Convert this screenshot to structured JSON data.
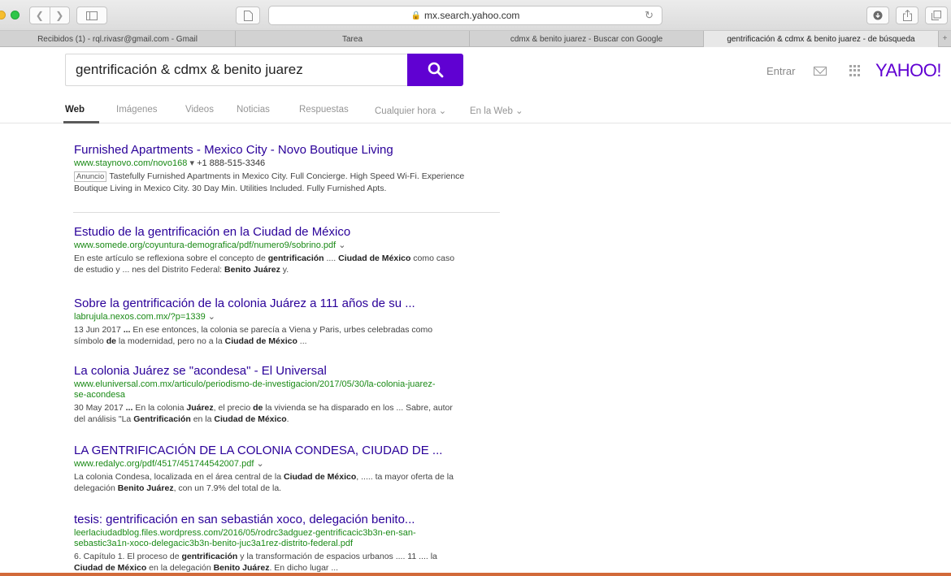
{
  "browser": {
    "url": "mx.search.yahoo.com",
    "tabs": [
      {
        "label": "Recibidos (1) - rql.rivasr@gmail.com - Gmail"
      },
      {
        "label": "Tarea"
      },
      {
        "label": "cdmx & benito juarez - Buscar con Google"
      },
      {
        "label": "gentrificación & cdmx & benito juarez - de búsqueda"
      }
    ],
    "new_tab_label": "+"
  },
  "header": {
    "query": "gentrificación & cdmx & benito juarez",
    "signin": "Entrar",
    "logo": "YAHOO!",
    "brand_color": "#6001d2"
  },
  "nav": {
    "tabs": [
      "Web",
      "Imágenes",
      "Videos",
      "Noticias",
      "Respuestas",
      "Cualquier hora ⌄",
      "En la Web ⌄"
    ]
  },
  "ad": {
    "title": "Furnished Apartments - Mexico City - Novo Boutique Living",
    "url": "www.staynovo.com/novo168",
    "url_arrow": "▾",
    "phone": "+1 888-515-3346",
    "label": "Anuncio",
    "snippet_line1": "Tastefully Furnished Apartments in Mexico City. Full Concierge. High Speed Wi-Fi. Experience",
    "snippet_line2": "Boutique Living in Mexico City. 30 Day Min. Utilities Included. Fully Furnished Apts."
  },
  "results": [
    {
      "title": "Estudio de la gentrificación en la Ciudad de México",
      "url": "www.somede.org/coyuntura-demografica/pdf/numero9/sobrino.pdf",
      "arrow": "⌄",
      "s1": "En este artículo se reflexiona sobre el concepto de ",
      "s1b": "gentrificación",
      "s2": " .... ",
      "s2b": "Ciudad de México",
      "s3": " como caso",
      "s4": "de estudio y ... nes del Distrito Federal: ",
      "s4b": "Benito Juárez",
      "s5": " y."
    },
    {
      "title": "Sobre la gentrificación de la colonia Juárez a 111 años de su ...",
      "url": "labrujula.nexos.com.mx/?p=1339",
      "arrow": "⌄",
      "s1": "13 Jun 2017 ",
      "s1b": "...",
      "s2": " En ese entonces, la colonia se parecía a Viena y Paris, urbes celebradas como",
      "s3": "símbolo ",
      "s3b": "de",
      "s4": " la modernidad, pero no a la ",
      "s4b": "Ciudad de México",
      "s5": " ..."
    },
    {
      "title": "La colonia Juárez se \"acondesa\" - El Universal",
      "url1": "www.eluniversal.com.mx/articulo/periodismo-de-investigacion/2017/05/30/la-colonia-juarez-",
      "url2": "se-acondesa",
      "s1": "30 May 2017 ",
      "s1b": "...",
      "s2": " En la colonia ",
      "s2b": "Juárez",
      "s3": ", el precio ",
      "s3b": "de",
      "s4": " la vivienda se ha disparado en los ... Sabre, autor",
      "s5": "del análisis \"La ",
      "s5b": "Gentrificación",
      "s6": " en la ",
      "s6b": "Ciudad de México",
      "s7": "."
    },
    {
      "title": "LA GENTRIFICACIÓN DE LA COLONIA CONDESA, CIUDAD DE ...",
      "url": "www.redalyc.org/pdf/4517/451744542007.pdf",
      "arrow": "⌄",
      "s1": "La colonia Condesa, localizada en el área central de la ",
      "s1b": "Ciudad de México",
      "s2": ", ..... ta mayor oferta de la",
      "s3": "delegación ",
      "s3b": "Benito Juárez",
      "s4": ", con un 7.9% del total de la."
    },
    {
      "title": "tesis: gentrificación en san sebastián xoco, delegación benito...",
      "url1": "leerlaciudadblog.files.wordpress.com/2016/05/rodrc3adguez-gentrificacic3b3n-en-san-",
      "url2": "sebastic3a1n-xoco-delegacic3b3n-benito-juc3a1rez-distrito-federal.pdf",
      "s1": "6. Capítulo 1. El proceso de ",
      "s1b": "gentrificación",
      "s2": " y la transformación de espacios urbanos .... 11 .... la",
      "s3b": "Ciudad de México",
      "s4": " en la delegación ",
      "s4b": "Benito Juárez",
      "s5": ". En dicho lugar ..."
    }
  ]
}
